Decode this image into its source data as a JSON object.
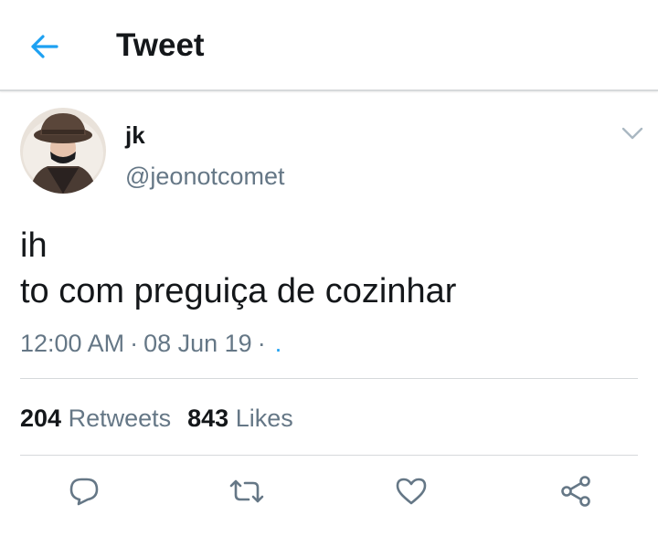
{
  "header": {
    "title": "Tweet",
    "back_icon": "arrow-left-icon"
  },
  "tweet": {
    "author": {
      "display_name": "jk",
      "handle": "@jeonotcomet"
    },
    "text_lines": [
      "ih",
      "to com preguiça de cozinhar"
    ],
    "time": "12:00 AM",
    "separator": "·",
    "date": "08 Jun 19",
    "source": "."
  },
  "stats": {
    "retweets_count": "204",
    "retweets_label": "Retweets",
    "likes_count": "843",
    "likes_label": "Likes"
  },
  "actions": [
    {
      "icon": "reply-icon"
    },
    {
      "icon": "retweet-icon"
    },
    {
      "icon": "like-heart-icon"
    },
    {
      "icon": "share-icon"
    }
  ],
  "colors": {
    "accent": "#1da1f2",
    "text_primary": "#14171a",
    "text_secondary": "#657786",
    "divider": "#d6d9db"
  }
}
